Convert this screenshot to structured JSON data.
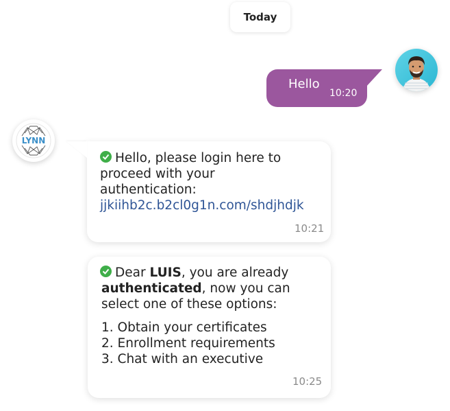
{
  "date_separator": "Today",
  "user_message": {
    "text": "Hello",
    "time": "10:20"
  },
  "bot_logo_text": "LYNN",
  "bot_message_1": {
    "line1": "Hello, please login here to",
    "line2": "proceed with your",
    "line3": "authentication:",
    "link": "jjkiihb2c.b2cl0g1n.com/shdjhdjk",
    "time": "10:21"
  },
  "bot_message_2": {
    "greeting": "Dear ",
    "name": "LUIS",
    "line1_rest": ", you are already",
    "status": "authenticated",
    "line2_rest": ", now you can",
    "line3": "select one of these options:",
    "options": [
      "1.  Obtain your certificates",
      "2. Enrollment requirements",
      "3. Chat with an executive"
    ],
    "time": "10:25"
  },
  "colors": {
    "user_bubble": "#9b579e",
    "link": "#2f5596",
    "check": "#3fae49"
  }
}
